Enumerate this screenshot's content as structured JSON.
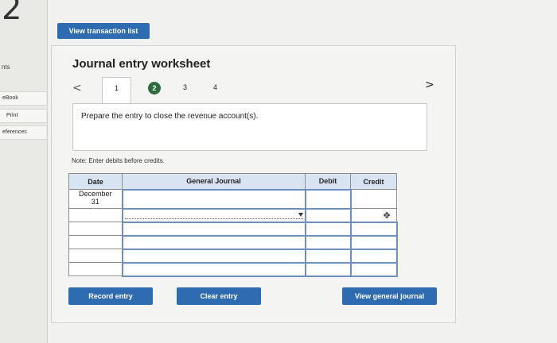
{
  "corner_number": "2",
  "sidebar": {
    "partial_label": "nts",
    "items": [
      {
        "label": "eBook"
      },
      {
        "label": "Print"
      },
      {
        "label": "eferences"
      }
    ]
  },
  "top_button_label": "View transaction list",
  "worksheet": {
    "title": "Journal entry worksheet",
    "nav_prev": "<",
    "nav_next": ">",
    "steps": [
      "1",
      "2",
      "3",
      "4"
    ],
    "current_step": "2",
    "instruction": "Prepare the entry to close the revenue account(s).",
    "note": "Note: Enter debits before credits."
  },
  "table": {
    "headers": [
      "Date",
      "General Journal",
      "Debit",
      "Credit"
    ],
    "first_date_line1": "December",
    "first_date_line2": "31"
  },
  "buttons": {
    "record": "Record entry",
    "clear": "Clear entry",
    "view_general": "View general journal"
  },
  "colors": {
    "button_blue": "#2f6bb0",
    "step_active": "#2e6b3f",
    "header_bg": "#d9e4f2"
  }
}
